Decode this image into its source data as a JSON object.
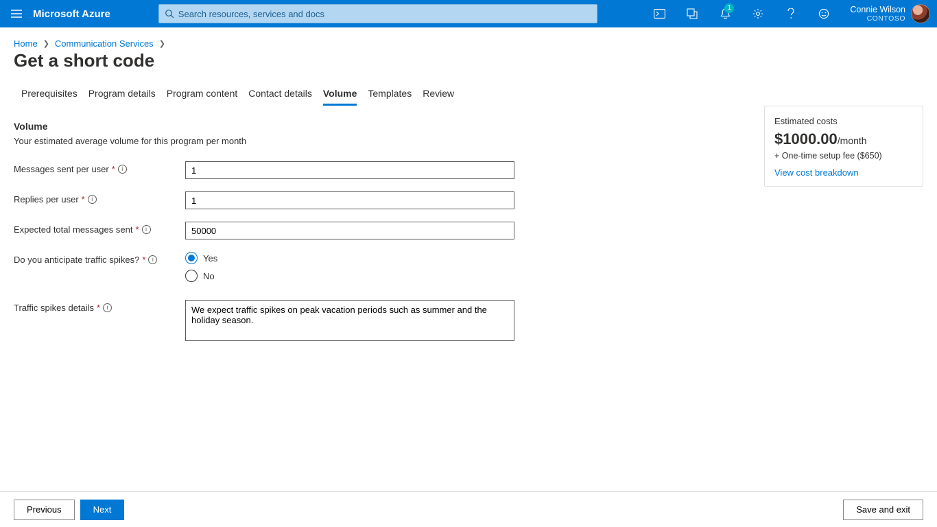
{
  "topbar": {
    "brand": "Microsoft Azure",
    "search_placeholder": "Search resources, services and docs",
    "notification_count": "1",
    "account_name": "Connie Wilson",
    "account_tenant": "CONTOSO"
  },
  "breadcrumbs": {
    "home": "Home",
    "comm": "Communication Services"
  },
  "page_title": "Get a short code",
  "tabs": [
    {
      "label": "Prerequisites"
    },
    {
      "label": "Program details"
    },
    {
      "label": "Program content"
    },
    {
      "label": "Contact details"
    },
    {
      "label": "Volume"
    },
    {
      "label": "Templates"
    },
    {
      "label": "Review"
    }
  ],
  "active_tab_index": 4,
  "section": {
    "heading": "Volume",
    "sub": "Your estimated average volume for this program per month"
  },
  "fields": {
    "messages_sent_label": "Messages sent per user",
    "messages_sent_value": "1",
    "replies_label": "Replies per user",
    "replies_value": "1",
    "expected_total_label": "Expected total messages sent",
    "expected_total_value": "50000",
    "spikes_label": "Do you anticipate traffic spikes?",
    "spikes_yes": "Yes",
    "spikes_no": "No",
    "spikes_selected": "yes",
    "spikes_details_label": "Traffic spikes details",
    "spikes_details_value": "We expect traffic spikes on peak vacation periods such as summer and the holiday season."
  },
  "cost": {
    "title": "Estimated costs",
    "amount": "$1000.00",
    "per": "/month",
    "setup": "+ One-time setup fee ($650)",
    "link": "View cost breakdown"
  },
  "footer": {
    "previous": "Previous",
    "next": "Next",
    "save_exit": "Save and exit"
  }
}
